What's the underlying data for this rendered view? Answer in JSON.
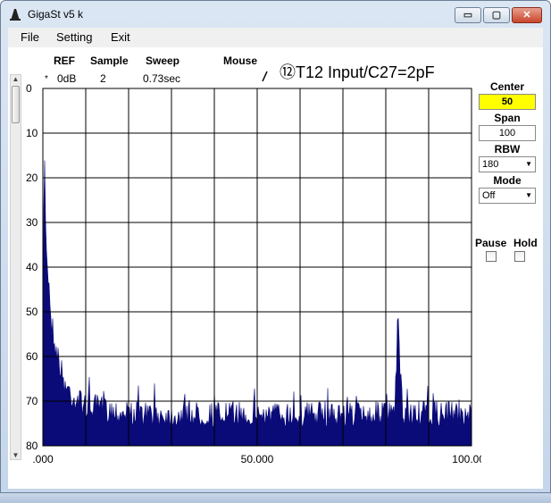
{
  "window": {
    "title": "GigaSt v5 k",
    "min_glyph": "▭",
    "max_glyph": "▢",
    "close_glyph": "✕"
  },
  "menu": {
    "items": [
      "File",
      "Setting",
      "Exit"
    ]
  },
  "header": {
    "ref_label": "REF",
    "ref_value": "0dB",
    "sample_label": "Sample",
    "sample_value": "2",
    "sweep_label": "Sweep",
    "sweep_value": "0.73sec",
    "mouse_label": "Mouse",
    "marker": "*",
    "annotation": "⑫T12 Input/C27=2pF"
  },
  "panel": {
    "center_label": "Center",
    "center_value": "50",
    "span_label": "Span",
    "span_value": "100",
    "rbw_label": "RBW",
    "rbw_value": "180",
    "mode_label": "Mode",
    "mode_value": "Off",
    "pause_label": "Pause",
    "hold_label": "Hold"
  },
  "colors": {
    "trace": "#0a0a78",
    "accent": "#ffff00"
  },
  "chart_data": {
    "type": "area",
    "title": "",
    "xlabel": "",
    "ylabel": "",
    "xlim": [
      0,
      100
    ],
    "ylim": [
      0,
      80
    ],
    "y_inverted": true,
    "grid": true,
    "x_ticks": [
      ".000",
      "50.000",
      "100.000"
    ],
    "y_ticks": [
      "0",
      "10",
      "20",
      "30",
      "40",
      "50",
      "60",
      "70",
      "80"
    ],
    "noise_floor": 73,
    "series": [
      {
        "x": [
          0,
          0.3,
          0.6,
          1,
          1.5,
          2,
          3,
          4,
          5,
          7,
          10,
          21,
          30,
          50,
          70,
          82,
          82.5,
          82.8,
          83.2,
          84,
          90,
          100
        ],
        "y": [
          80,
          5,
          30,
          38,
          45,
          52,
          58,
          62,
          66,
          69,
          71,
          73,
          73,
          73,
          73,
          73,
          62,
          48,
          62,
          73,
          73,
          73
        ]
      }
    ]
  }
}
